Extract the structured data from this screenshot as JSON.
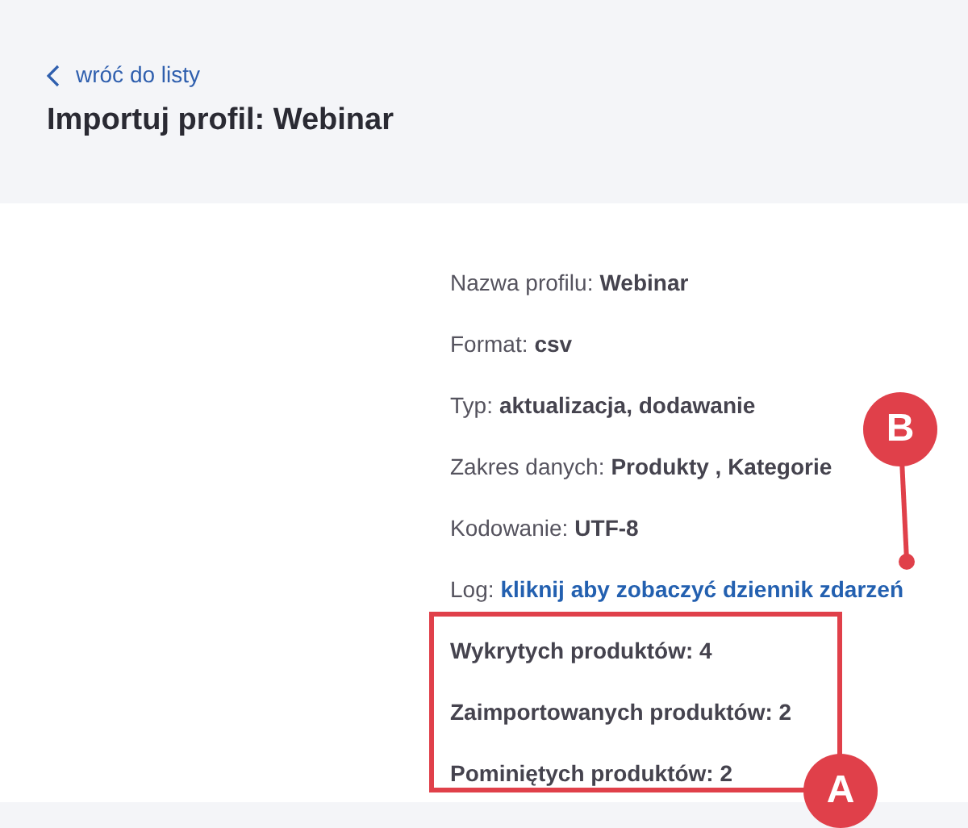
{
  "back_link": "wróć do listy",
  "title": "Importuj profil: Webinar",
  "details": [
    {
      "kind": "text",
      "label": "Nazwa profilu:",
      "value": "Webinar"
    },
    {
      "kind": "text",
      "label": "Format:",
      "value": "csv"
    },
    {
      "kind": "text",
      "label": "Typ:",
      "value": "aktualizacja, dodawanie"
    },
    {
      "kind": "text",
      "label": "Zakres danych:",
      "value": "Produkty , Kategorie"
    },
    {
      "kind": "text",
      "label": "Kodowanie:",
      "value": "UTF-8"
    },
    {
      "kind": "link",
      "label": "Log:",
      "value": "kliknij aby zobaczyć dziennik zdarzeń"
    }
  ],
  "stats": [
    "Wykrytych produktów: 4",
    "Zaimportowanych produktów: 2",
    "Pominiętych produktów: 2"
  ],
  "callouts": [
    {
      "kind": "box",
      "label": "A"
    },
    {
      "kind": "pointer",
      "label": "B"
    }
  ]
}
